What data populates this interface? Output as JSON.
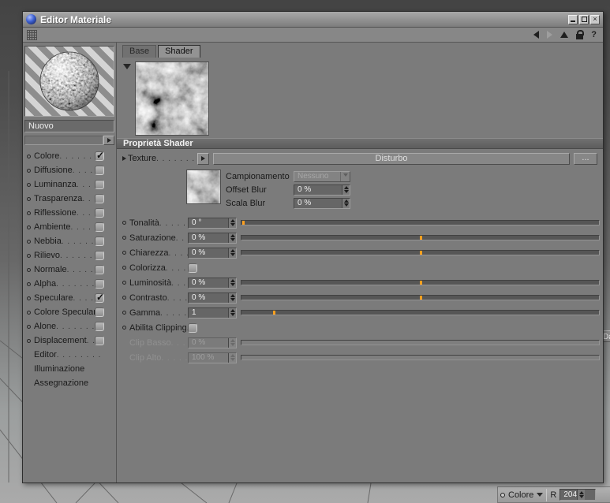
{
  "window": {
    "title": "Editor Materiale"
  },
  "toolbar": {
    "icons": [
      "grid-icon",
      "back-icon",
      "forward-icon",
      "up-icon",
      "lock-icon",
      "help-icon"
    ]
  },
  "left_panel": {
    "material_name": "Nuovo",
    "channels": [
      {
        "label": "Colore",
        "checkbox": true,
        "checked": true,
        "bullet": true,
        "dots": true
      },
      {
        "label": "Diffusione",
        "checkbox": true,
        "checked": false,
        "bullet": true,
        "dots": true
      },
      {
        "label": "Luminanza",
        "checkbox": true,
        "checked": false,
        "bullet": true,
        "dots": true
      },
      {
        "label": "Trasparenza",
        "checkbox": true,
        "checked": false,
        "bullet": true,
        "dots": true
      },
      {
        "label": "Riflessione",
        "checkbox": true,
        "checked": false,
        "bullet": true,
        "dots": true
      },
      {
        "label": "Ambiente",
        "checkbox": true,
        "checked": false,
        "bullet": true,
        "dots": true
      },
      {
        "label": "Nebbia",
        "checkbox": true,
        "checked": false,
        "bullet": true,
        "dots": true
      },
      {
        "label": "Rilievo",
        "checkbox": true,
        "checked": false,
        "bullet": true,
        "dots": true
      },
      {
        "label": "Normale",
        "checkbox": true,
        "checked": false,
        "bullet": true,
        "dots": true
      },
      {
        "label": "Alpha",
        "checkbox": true,
        "checked": false,
        "bullet": true,
        "dots": true
      },
      {
        "label": "Speculare",
        "checkbox": true,
        "checked": true,
        "bullet": true,
        "dots": true
      },
      {
        "label": "Colore Speculare",
        "checkbox": true,
        "checked": false,
        "bullet": true,
        "dots": false
      },
      {
        "label": "Alone",
        "checkbox": true,
        "checked": false,
        "bullet": true,
        "dots": true
      },
      {
        "label": "Displacement",
        "checkbox": true,
        "checked": false,
        "bullet": true,
        "dots": true
      },
      {
        "label": "Editor",
        "checkbox": false,
        "checked": false,
        "bullet": false,
        "dots": true
      },
      {
        "label": "Illuminazione",
        "checkbox": false,
        "checked": false,
        "bullet": false,
        "dots": false
      },
      {
        "label": "Assegnazione",
        "checkbox": false,
        "checked": false,
        "bullet": false,
        "dots": false
      }
    ]
  },
  "shader_panel": {
    "tabs": [
      {
        "label": "Base",
        "active": false
      },
      {
        "label": "Shader",
        "active": true
      }
    ],
    "section_header": "Proprietà Shader",
    "texture": {
      "label": "Texture",
      "shader_name": "Disturbo",
      "browse_label": "..."
    },
    "texture_options": [
      {
        "label": "Campionamento",
        "value": "Nessuno",
        "control": "dropdown",
        "disabled": true
      },
      {
        "label": "Offset Blur",
        "value": "0 %",
        "control": "spinner",
        "disabled": false
      },
      {
        "label": "Scala Blur",
        "value": "0 %",
        "control": "spinner",
        "disabled": false
      }
    ],
    "rows": [
      {
        "label": "Tonalità",
        "type": "slider",
        "value": "0 °",
        "marker": 0.004
      },
      {
        "label": "Saturazione",
        "type": "slider",
        "value": "0 %",
        "marker": 0.5
      },
      {
        "label": "Chiarezza",
        "type": "slider",
        "value": "0 %",
        "marker": 0.5
      },
      {
        "label": "Colorizza",
        "type": "checkbox",
        "checked": false
      },
      {
        "label": "Luminosità",
        "type": "slider",
        "value": "0 %",
        "marker": 0.5
      },
      {
        "label": "Contrasto",
        "type": "slider",
        "value": "0 %",
        "marker": 0.5
      },
      {
        "label": "Gamma",
        "type": "slider",
        "value": "1",
        "marker": 0.09
      },
      {
        "label": "Abilita Clipping",
        "type": "checkbox",
        "checked": false
      },
      {
        "label": "Clip Basso",
        "type": "slider",
        "value": "0 %",
        "disabled": true
      },
      {
        "label": "Clip Alto",
        "type": "slider",
        "value": "100 %",
        "disabled": true
      }
    ]
  },
  "status_bar": {
    "color_label": "Colore",
    "channel_label": "R",
    "channel_value": "204"
  },
  "background_fragment": "Da",
  "colors": {
    "accent_orange": "#ffa01e",
    "window_gray": "#7b7b7b"
  }
}
